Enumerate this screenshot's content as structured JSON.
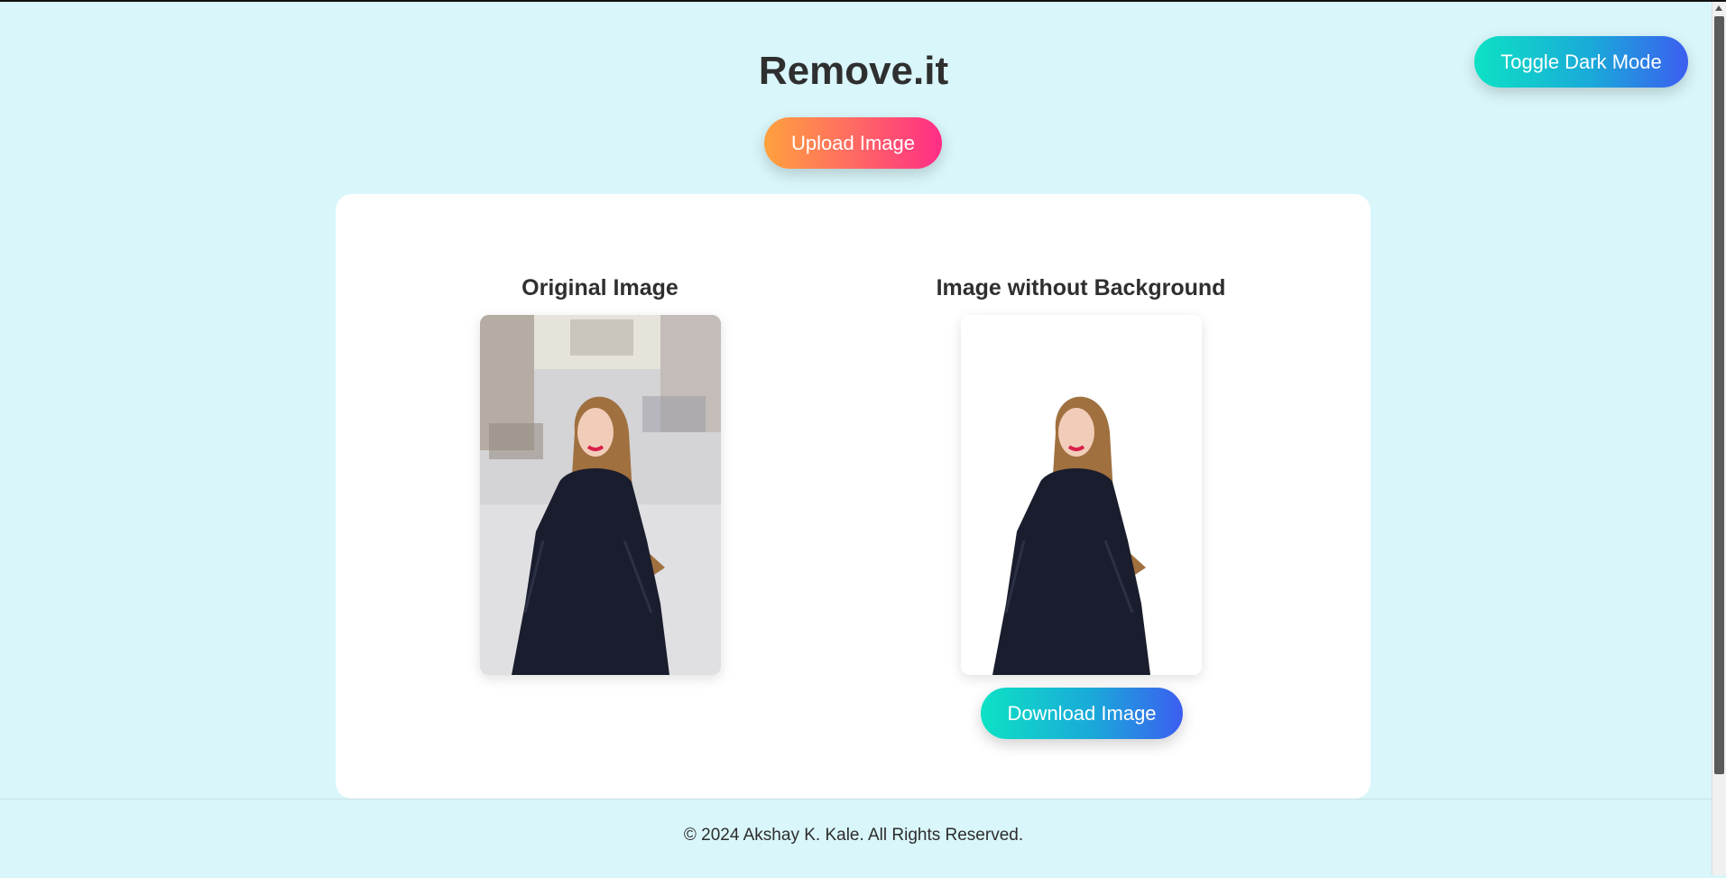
{
  "app": {
    "title": "Remove.it"
  },
  "header": {
    "toggle_dark_mode_label": "Toggle Dark Mode",
    "upload_label": "Upload Image"
  },
  "panels": {
    "original": {
      "title": "Original Image"
    },
    "processed": {
      "title": "Image without Background",
      "download_label": "Download Image"
    }
  },
  "footer": {
    "copyright": "© 2024 Akshay K. Kale. All Rights Reserved."
  },
  "colors": {
    "page_background": "#d9f6fa",
    "card_background": "#ffffff",
    "teal_blue_gradient": [
      "#0de2c4",
      "#3c5ef0"
    ],
    "orange_pink_gradient": [
      "#ffa13e",
      "#ff2d86"
    ]
  },
  "icons": {
    "scrollbar_up": "triangle-up"
  }
}
